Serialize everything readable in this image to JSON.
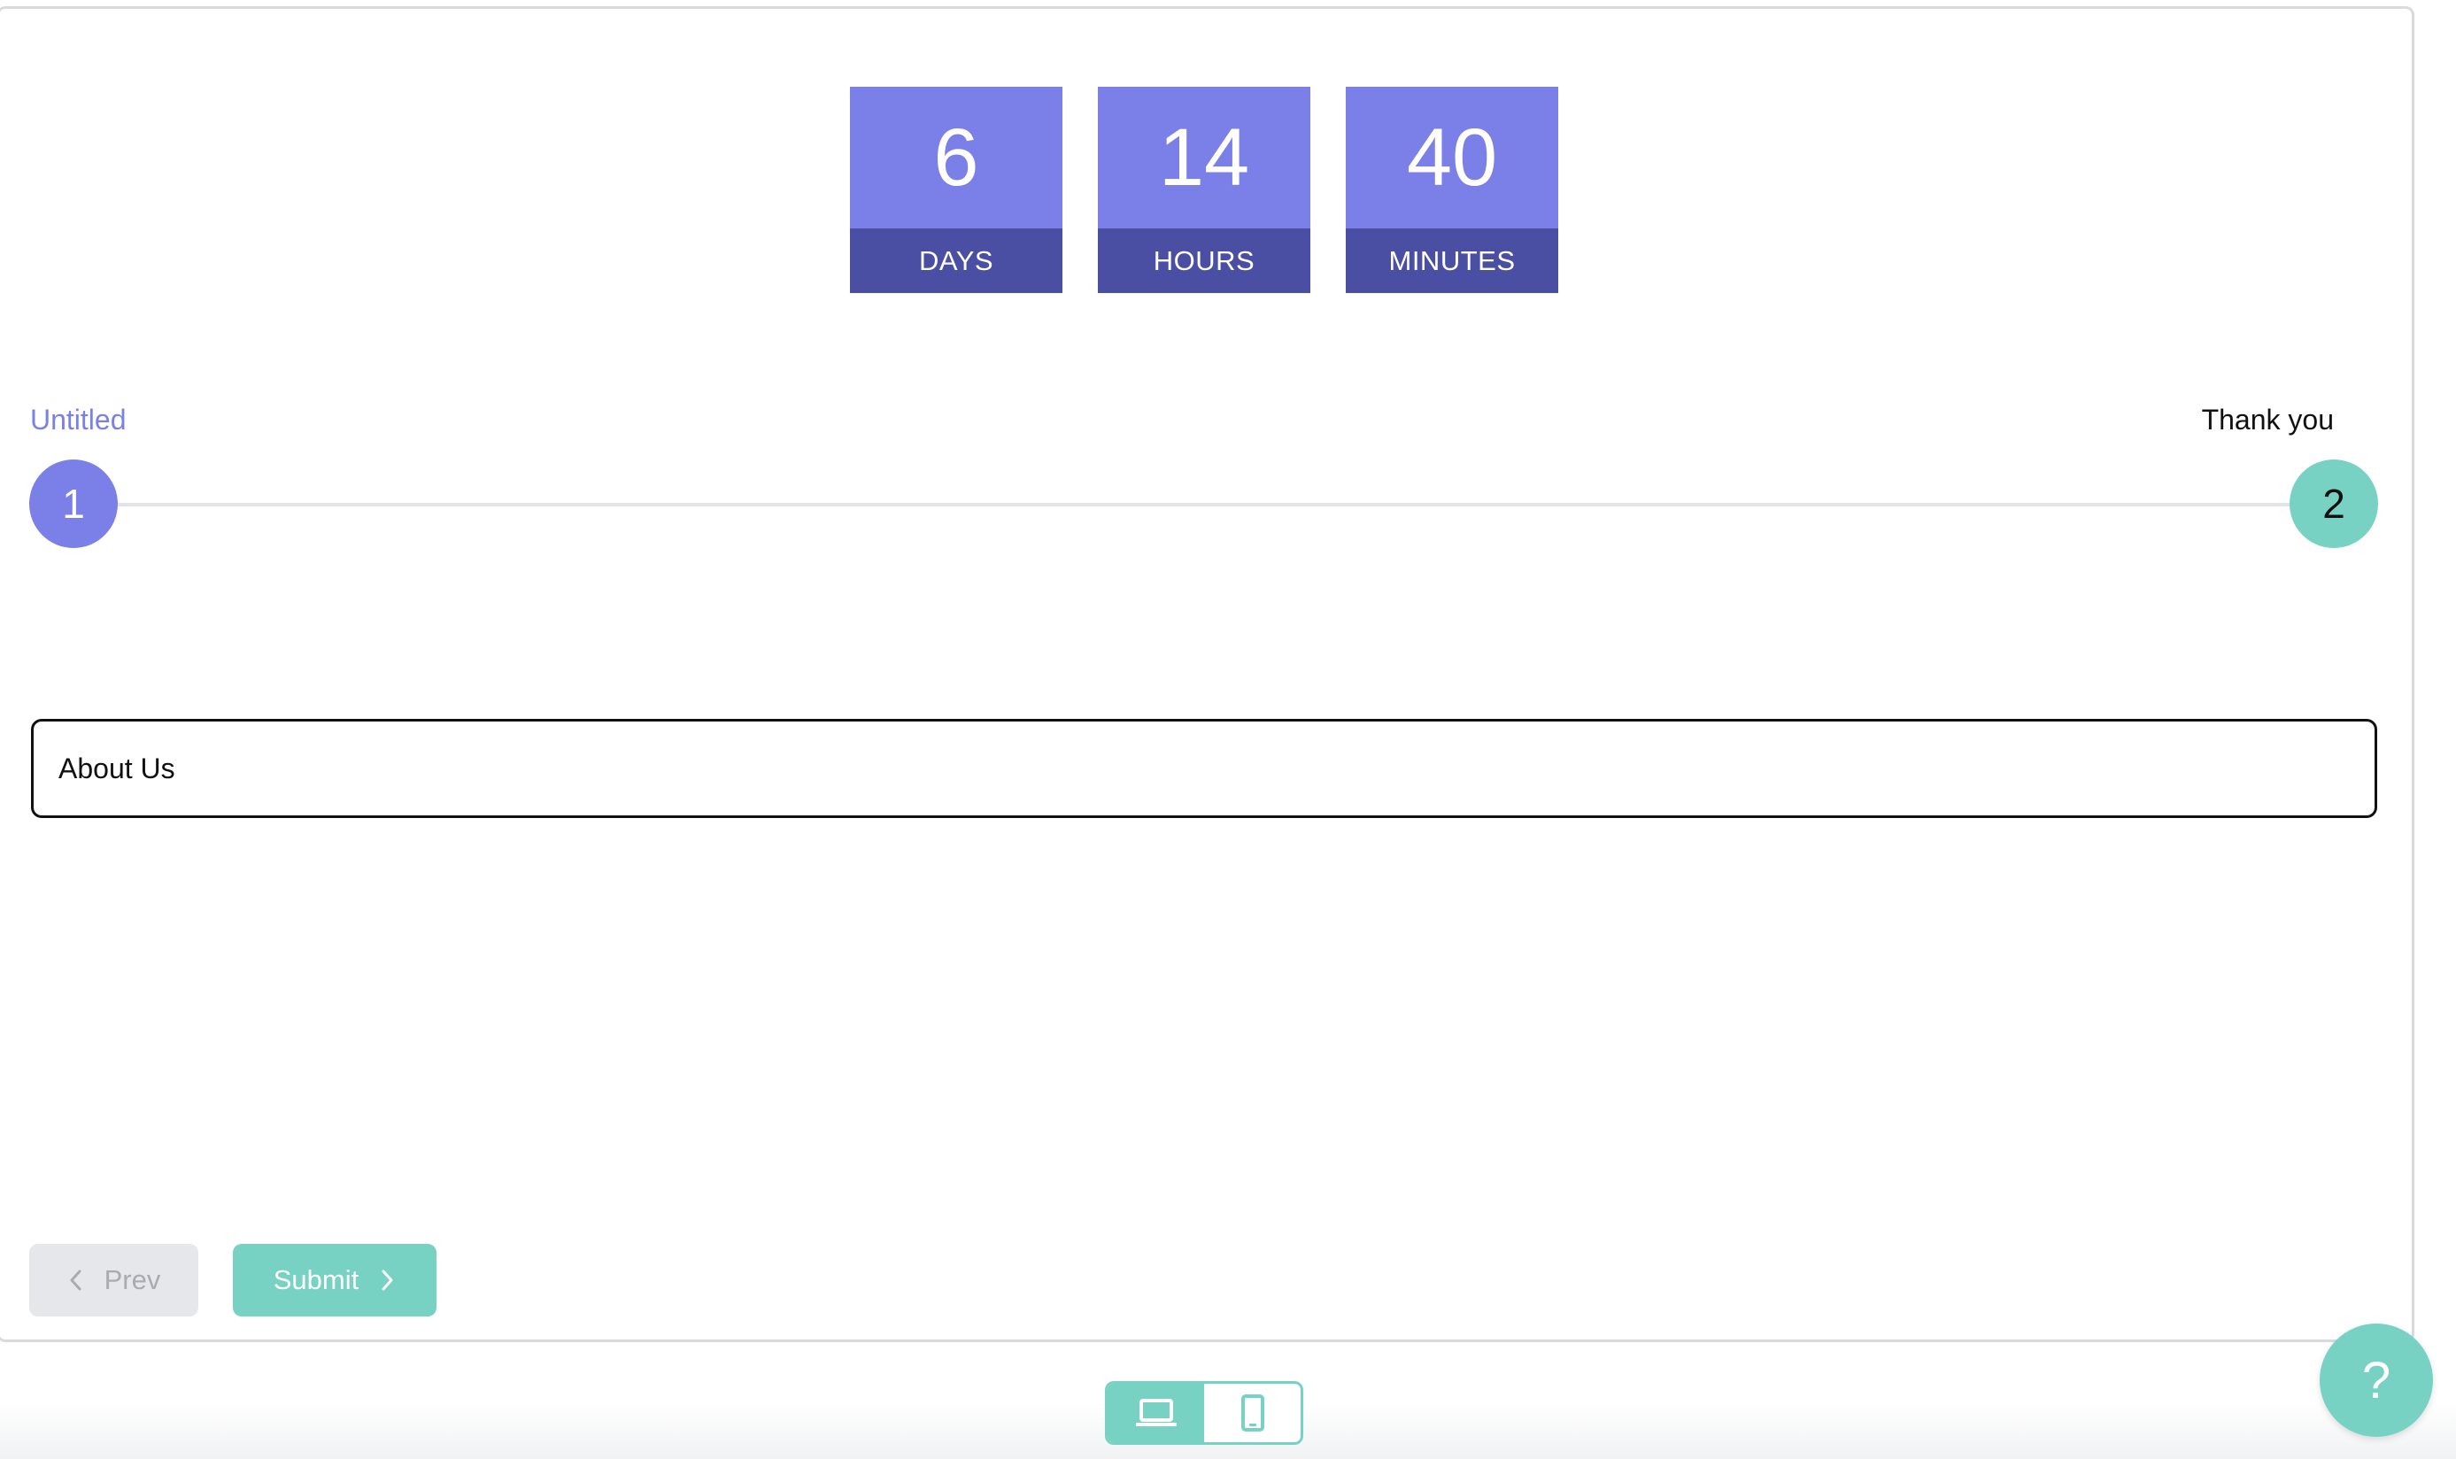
{
  "countdown": {
    "days": {
      "value": "6",
      "label": "DAYS"
    },
    "hours": {
      "value": "14",
      "label": "HOURS"
    },
    "minutes": {
      "value": "40",
      "label": "MINUTES"
    }
  },
  "stepper": {
    "steps": [
      {
        "number": "1",
        "label": "Untitled",
        "status": "current"
      },
      {
        "number": "2",
        "label": "Thank you",
        "status": "upcoming"
      }
    ]
  },
  "form": {
    "field_text": "About Us"
  },
  "nav": {
    "prev_label": "Prev",
    "submit_label": "Submit"
  },
  "view_toggle": {
    "options": [
      {
        "icon": "laptop-icon",
        "selected": true
      },
      {
        "icon": "mobile-icon",
        "selected": false
      }
    ]
  },
  "help": {
    "label": "?"
  },
  "colors": {
    "primary": "#7b7fe8",
    "primary_dark": "#4b4fa3",
    "accent": "#77d2c3"
  }
}
